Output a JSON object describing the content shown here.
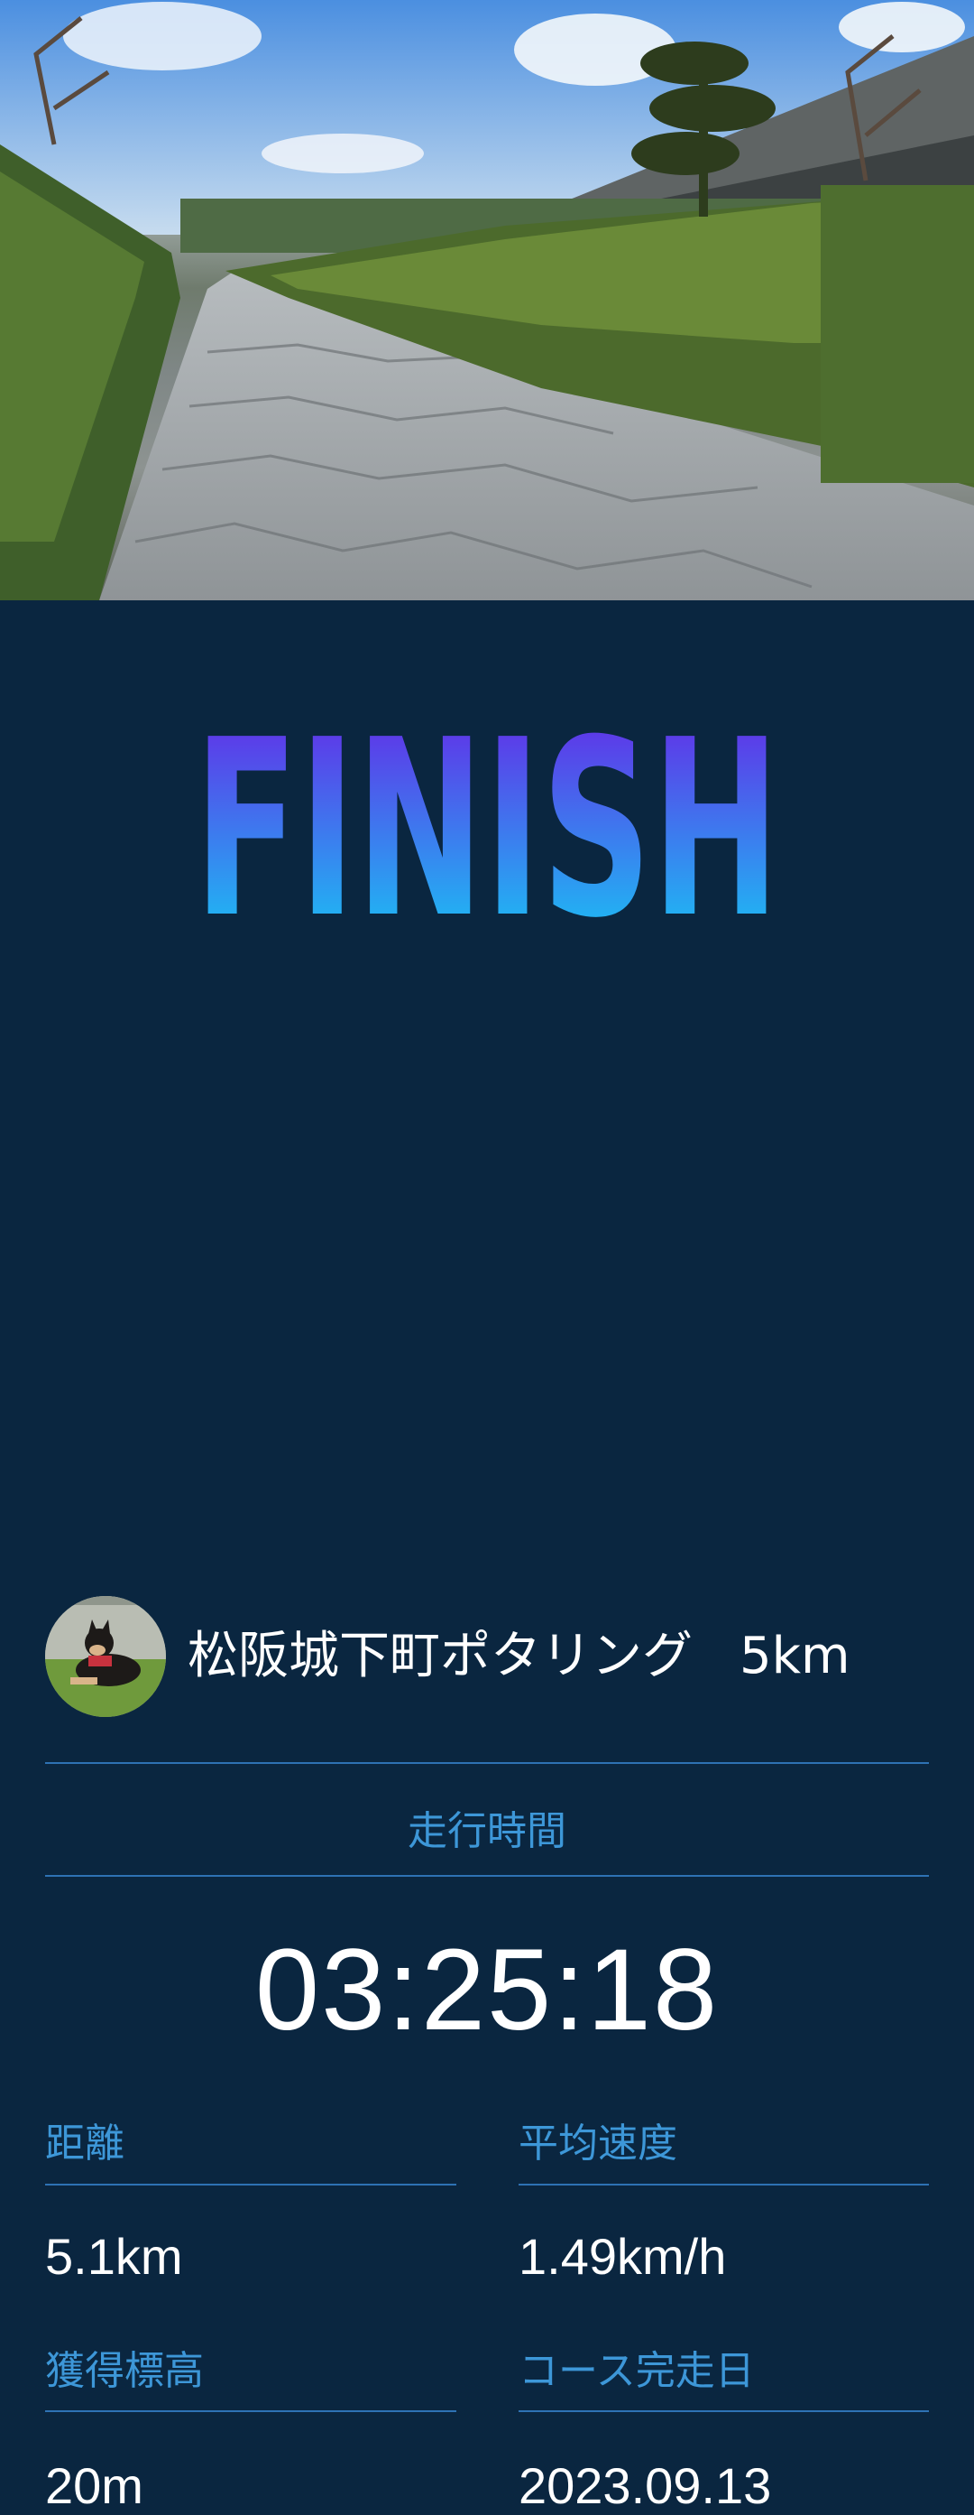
{
  "hero": {
    "image": "stone-paved-path-photo"
  },
  "finish": {
    "text": "FINISH",
    "gradient_top": "#6a1ee6",
    "gradient_bottom": "#12d2f6"
  },
  "course": {
    "avatar": "shiba-dog-avatar",
    "name": "松阪城下町ポタリング",
    "distance": "5km"
  },
  "running_time": {
    "label": "走行時間",
    "value": "03:25:18"
  },
  "stats": {
    "distance": {
      "label": "距離",
      "value": "5.1km"
    },
    "avg_speed": {
      "label": "平均速度",
      "value": "1.49km/h"
    },
    "elevation": {
      "label": "獲得標高",
      "value": "20m"
    },
    "completion_date": {
      "label": "コース完走日",
      "value": "2023.09.13"
    }
  },
  "colors": {
    "background": "#0a2640",
    "accent_text": "#3d97d8",
    "divider": "#2e72b4",
    "text": "#ffffff"
  }
}
